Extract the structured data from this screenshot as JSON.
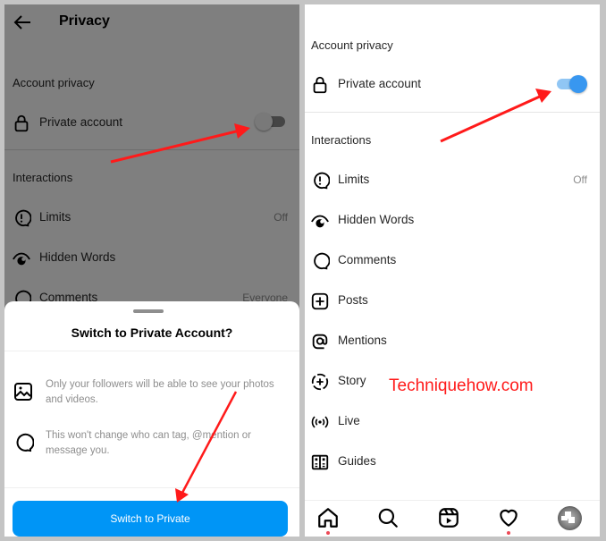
{
  "left_screen": {
    "header": {
      "title": "Privacy",
      "back_icon": "arrow-left-icon"
    },
    "account_privacy": {
      "heading": "Account privacy",
      "private_account": {
        "label": "Private account",
        "icon": "lock-icon",
        "enabled": false
      }
    },
    "interactions": {
      "heading": "Interactions",
      "items": [
        {
          "label": "Limits",
          "icon": "limits-icon",
          "value": "Off"
        },
        {
          "label": "Hidden Words",
          "icon": "hidden-words-icon",
          "value": ""
        },
        {
          "label": "Comments",
          "icon": "comment-icon",
          "value": "Everyone"
        }
      ]
    },
    "dialog": {
      "title": "Switch to Private Account?",
      "items": [
        {
          "icon": "photo-icon",
          "text": "Only your followers will be able to see your photos and videos."
        },
        {
          "icon": "comment-icon",
          "text": "This won't change who can tag, @mention or message you."
        }
      ],
      "confirm_button": "Switch to Private"
    }
  },
  "right_screen": {
    "account_privacy": {
      "heading": "Account privacy",
      "private_account": {
        "label": "Private account",
        "icon": "lock-icon",
        "enabled": true
      }
    },
    "interactions": {
      "heading": "Interactions",
      "items": [
        {
          "label": "Limits",
          "icon": "limits-icon",
          "value": "Off"
        },
        {
          "label": "Hidden Words",
          "icon": "hidden-words-icon",
          "value": ""
        },
        {
          "label": "Comments",
          "icon": "comment-icon",
          "value": ""
        },
        {
          "label": "Posts",
          "icon": "plus-square-icon",
          "value": ""
        },
        {
          "label": "Mentions",
          "icon": "at-icon",
          "value": ""
        },
        {
          "label": "Story",
          "icon": "story-add-icon",
          "value": ""
        },
        {
          "label": "Live",
          "icon": "live-icon",
          "value": ""
        },
        {
          "label": "Guides",
          "icon": "guides-icon",
          "value": ""
        }
      ]
    },
    "bottom_nav": [
      {
        "name": "home",
        "icon": "home-icon",
        "badge": true
      },
      {
        "name": "search",
        "icon": "search-icon",
        "badge": false
      },
      {
        "name": "reels",
        "icon": "reels-icon",
        "badge": false
      },
      {
        "name": "activity",
        "icon": "heart-icon",
        "badge": true
      },
      {
        "name": "profile",
        "icon": "avatar",
        "badge": false
      }
    ]
  },
  "watermark": "Techniquehow.com",
  "colors": {
    "primary_blue": "#0095f6",
    "toggle_on": "#3897f0",
    "annotation_arrow": "#ff1a1a",
    "notification_dot": "#ed4956"
  }
}
